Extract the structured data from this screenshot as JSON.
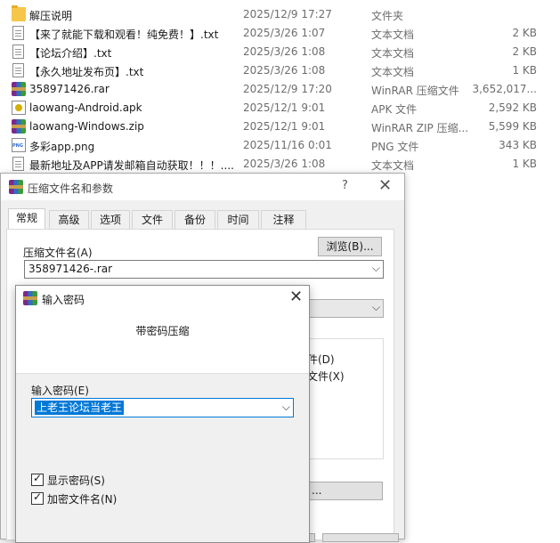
{
  "files": [
    {
      "icon": "folder-icon",
      "kind": "folder",
      "name": "解压说明",
      "date": "2025/12/9 17:27",
      "type": "文件夹",
      "size": ""
    },
    {
      "icon": "text-file-icon",
      "kind": "doc",
      "name": "【来了就能下载和观看！纯免费！】.txt",
      "date": "2025/3/26 1:07",
      "type": "文本文档",
      "size": "2 KB"
    },
    {
      "icon": "text-file-icon",
      "kind": "doc",
      "name": "【论坛介绍】.txt",
      "date": "2025/3/26 1:08",
      "type": "文本文档",
      "size": "2 KB"
    },
    {
      "icon": "text-file-icon",
      "kind": "doc",
      "name": "【永久地址发布页】.txt",
      "date": "2025/3/26 1:08",
      "type": "文本文档",
      "size": "1 KB"
    },
    {
      "icon": "winrar-icon",
      "kind": "rar",
      "name": "358971426.rar",
      "date": "2025/12/9 17:20",
      "type": "WinRAR 压缩文件",
      "size": "3,652,017..."
    },
    {
      "icon": "apk-file-icon",
      "kind": "apk",
      "name": "laowang-Android.apk",
      "date": "2025/12/1 9:01",
      "type": "APK 文件",
      "size": "2,592 KB"
    },
    {
      "icon": "winrar-icon",
      "kind": "rar",
      "name": "laowang-Windows.zip",
      "date": "2025/12/1 9:01",
      "type": "WinRAR ZIP 压缩...",
      "size": "5,599 KB"
    },
    {
      "icon": "png-file-icon",
      "kind": "png",
      "name": "多彩app.png",
      "date": "2025/11/16 0:01",
      "type": "PNG 文件",
      "size": "343 KB"
    },
    {
      "icon": "text-file-icon",
      "kind": "doc",
      "name": "最新地址及APP请发邮箱自动获取！！！....",
      "date": "2025/3/26 1:08",
      "type": "文本文档",
      "size": "1 KB"
    }
  ],
  "archive_dialog": {
    "title": "压缩文件名和参数",
    "help": "?",
    "close": "✕",
    "tabs": [
      "常规",
      "高级",
      "选项",
      "文件",
      "备份",
      "时间",
      "注释"
    ],
    "archive_label": "压缩文件名(A)",
    "browse": "浏览(B)...",
    "archive_value": "358971426-.rar",
    "partial_option_1": "件(D)",
    "partial_option_2": "文件(X)",
    "partial_button": "..."
  },
  "password_dialog": {
    "title": "输入密码",
    "close": "✕",
    "heading": "带密码压缩",
    "password_label": "输入密码(E)",
    "password_value": "上老王论坛当老王",
    "show_password": "显示密码(S)",
    "encrypt_names": "加密文件名(N)",
    "show_password_checked": true,
    "encrypt_names_checked": true
  }
}
